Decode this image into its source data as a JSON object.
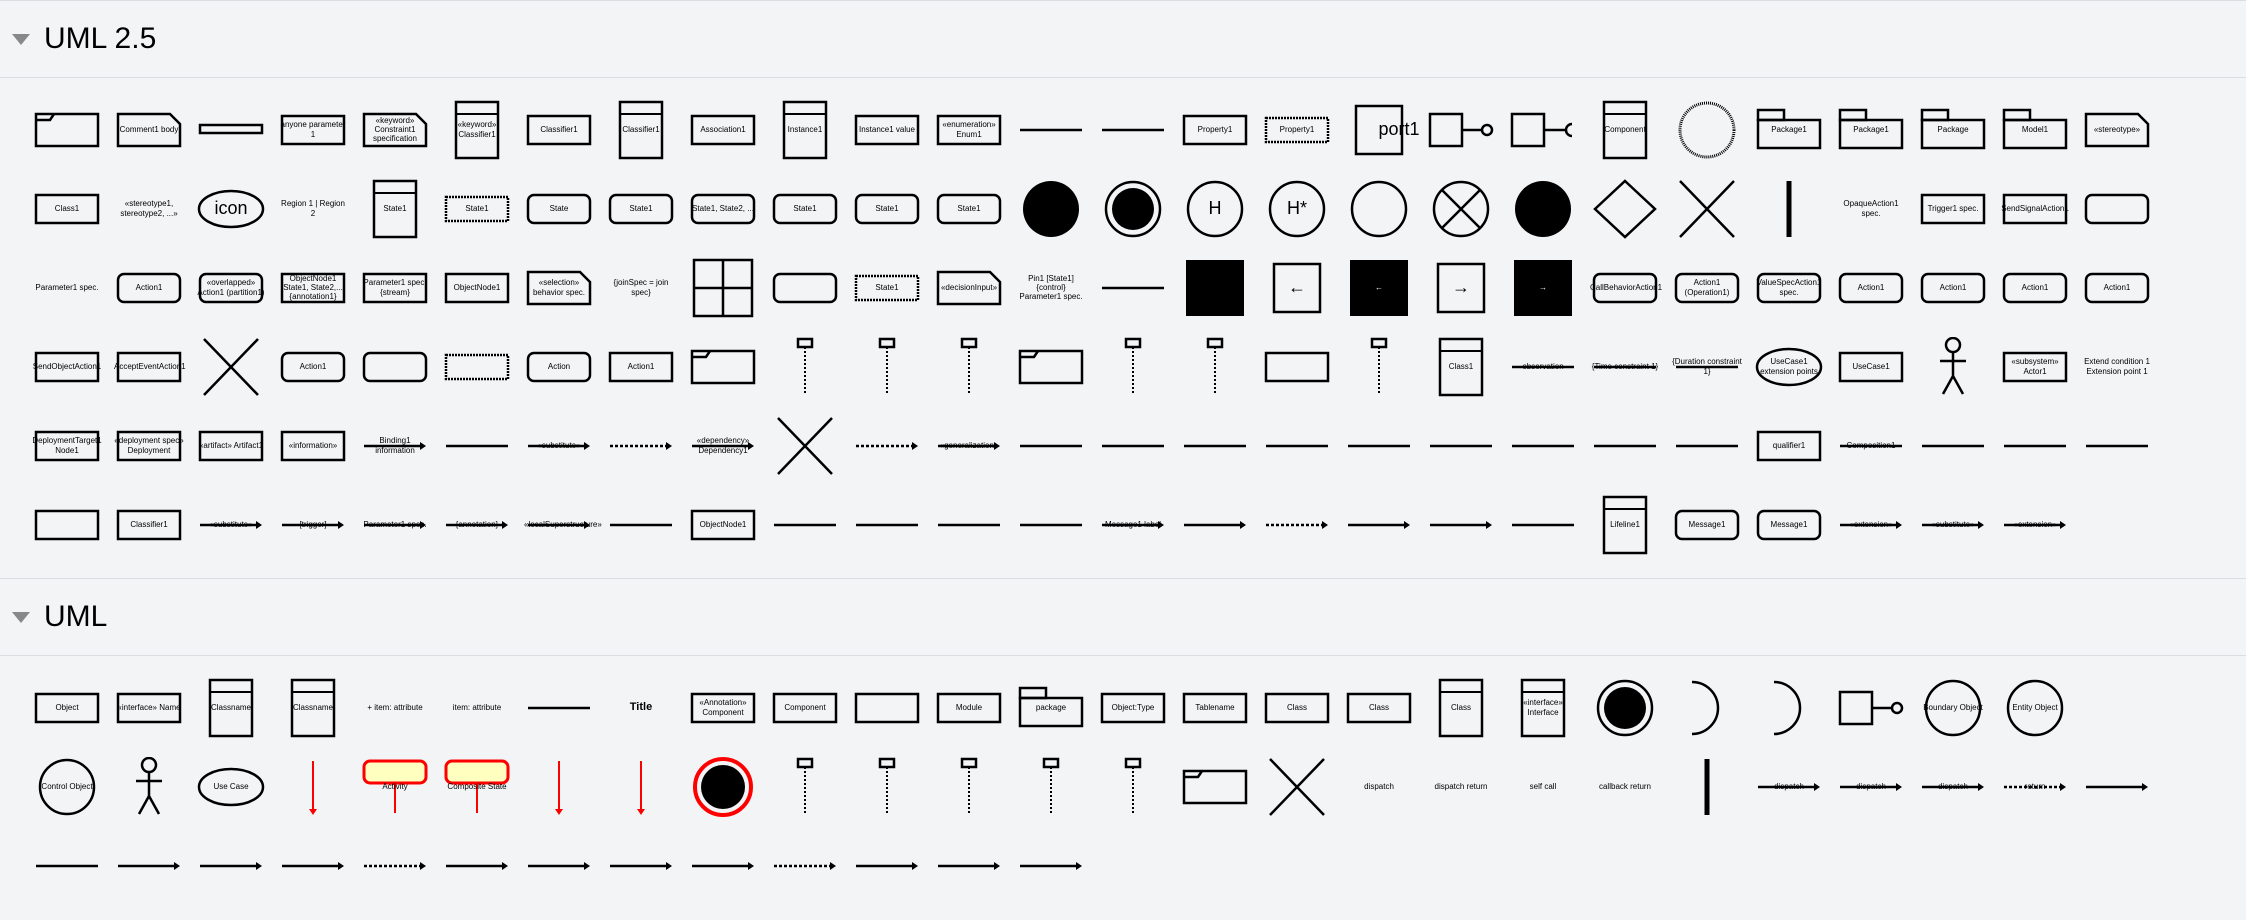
{
  "sections": [
    {
      "title": "UML 2.5",
      "rows": [
        [
          {
            "t": "frame",
            "l": ""
          },
          {
            "t": "note",
            "l": "Comment1 body"
          },
          {
            "t": "thin",
            "l": ""
          },
          {
            "t": "box",
            "l": "anyone parameter 1"
          },
          {
            "t": "note",
            "l": "«keyword» Constraint1 specification"
          },
          {
            "t": "tall",
            "l": "«keyword» Classifier1"
          },
          {
            "t": "box",
            "l": "Classifier1"
          },
          {
            "t": "tall",
            "l": "Classifier1"
          },
          {
            "t": "box",
            "l": "Association1"
          },
          {
            "t": "tall",
            "l": "Instance1"
          },
          {
            "t": "box",
            "l": "Instance1 value"
          },
          {
            "t": "box",
            "l": "«enumeration» Enum1"
          },
          {
            "t": "line",
            "l": ""
          },
          {
            "t": "line",
            "l": ""
          },
          {
            "t": "box",
            "l": "Property1"
          },
          {
            "t": "dbox",
            "l": "Property1"
          },
          {
            "t": "sq",
            "l": "port1"
          },
          {
            "t": "lollipop",
            "l": ""
          },
          {
            "t": "socket",
            "l": ""
          },
          {
            "t": "tall",
            "l": "Component"
          },
          {
            "t": "dcircle",
            "l": ""
          },
          {
            "t": "pkg",
            "l": "Package1"
          },
          {
            "t": "pkg",
            "l": "Package1"
          },
          {
            "t": "pkg",
            "l": "Package"
          },
          {
            "t": "pkg",
            "l": "Model1"
          },
          {
            "t": "note",
            "l": "«stereotype»"
          }
        ],
        [
          {
            "t": "box",
            "l": "Class1"
          },
          {
            "t": "text",
            "l": "«stereotype1, stereotype2, ...»"
          },
          {
            "t": "ellipse",
            "l": "icon"
          },
          {
            "t": "text",
            "l": "Region 1 | Region 2"
          },
          {
            "t": "tall",
            "l": "State1"
          },
          {
            "t": "dbox",
            "l": "State1"
          },
          {
            "t": "rbox",
            "l": "State"
          },
          {
            "t": "rbox",
            "l": "State1"
          },
          {
            "t": "rbox",
            "l": "State1, State2, ..."
          },
          {
            "t": "rbox",
            "l": "State1"
          },
          {
            "t": "rbox",
            "l": "State1"
          },
          {
            "t": "rbox",
            "l": "State1"
          },
          {
            "t": "filled",
            "l": ""
          },
          {
            "t": "ring",
            "l": ""
          },
          {
            "t": "circle",
            "l": "H"
          },
          {
            "t": "circle",
            "l": "H*"
          },
          {
            "t": "circle",
            "l": ""
          },
          {
            "t": "xcircle",
            "l": ""
          },
          {
            "t": "filled",
            "l": ""
          },
          {
            "t": "diamond",
            "l": ""
          },
          {
            "t": "x",
            "l": ""
          },
          {
            "t": "bar",
            "l": ""
          },
          {
            "t": "text",
            "l": "OpaqueAction1 spec."
          },
          {
            "t": "box",
            "l": "Trigger1 spec."
          },
          {
            "t": "box",
            "l": "SendSignalAction1"
          },
          {
            "t": "rbox",
            "l": ""
          }
        ],
        [
          {
            "t": "text",
            "l": "Parameter1 spec."
          },
          {
            "t": "rbox",
            "l": "Action1"
          },
          {
            "t": "rbox",
            "l": "«overlapped» Action1 (partition1)"
          },
          {
            "t": "box",
            "l": "ObjectNode1 [State1, State2,...] {annotation1}"
          },
          {
            "t": "box",
            "l": "Parameter1 spec. {stream}"
          },
          {
            "t": "box",
            "l": "ObjectNode1"
          },
          {
            "t": "note",
            "l": "«selection» behavior spec."
          },
          {
            "t": "text",
            "l": "{joinSpec = join spec}"
          },
          {
            "t": "grid",
            "l": ""
          },
          {
            "t": "rbox",
            "l": ""
          },
          {
            "t": "dbox",
            "l": "State1"
          },
          {
            "t": "note",
            "l": "«decisionInput»"
          },
          {
            "t": "text",
            "l": "Pin1 [State1] {control} Parameter1 spec."
          },
          {
            "t": "line",
            "l": ""
          },
          {
            "t": "fsq",
            "l": ""
          },
          {
            "t": "sq",
            "l": "←"
          },
          {
            "t": "fsq",
            "l": "←"
          },
          {
            "t": "sq",
            "l": "→"
          },
          {
            "t": "fsq",
            "l": "→"
          },
          {
            "t": "rbox",
            "l": "CallBehaviorAction1"
          },
          {
            "t": "rbox",
            "l": "Action1 (Operation1)"
          },
          {
            "t": "rbox",
            "l": "ValueSpecAction1 spec."
          },
          {
            "t": "rbox",
            "l": "Action1"
          },
          {
            "t": "rbox",
            "l": "Action1"
          },
          {
            "t": "rbox",
            "l": "Action1"
          },
          {
            "t": "rbox",
            "l": "Action1"
          }
        ],
        [
          {
            "t": "box",
            "l": "SendObjectAction1"
          },
          {
            "t": "box",
            "l": "AcceptEventAction1"
          },
          {
            "t": "x",
            "l": ""
          },
          {
            "t": "rbox",
            "l": "Action1"
          },
          {
            "t": "rbox",
            "l": ""
          },
          {
            "t": "dbox",
            "l": ""
          },
          {
            "t": "rbox",
            "l": "Action"
          },
          {
            "t": "box",
            "l": "Action1"
          },
          {
            "t": "frame",
            "l": ""
          },
          {
            "t": "lifeline",
            "l": ""
          },
          {
            "t": "lifeline",
            "l": ""
          },
          {
            "t": "lifeline",
            "l": ""
          },
          {
            "t": "frame",
            "l": ""
          },
          {
            "t": "lifeline",
            "l": ""
          },
          {
            "t": "lifeline",
            "l": ""
          },
          {
            "t": "box",
            "l": ""
          },
          {
            "t": "lifeline",
            "l": ""
          },
          {
            "t": "tall",
            "l": "Class1"
          },
          {
            "t": "line",
            "l": "observation"
          },
          {
            "t": "line",
            "l": "{Time constraint 1}"
          },
          {
            "t": "line",
            "l": "{Duration constraint 1}"
          },
          {
            "t": "ellipse",
            "l": "UseCase1 extension points"
          },
          {
            "t": "box",
            "l": "UseCase1"
          },
          {
            "t": "actor",
            "l": ""
          },
          {
            "t": "box",
            "l": "«subsystem» Actor1"
          },
          {
            "t": "text",
            "l": "Extend condition 1 Extension point 1"
          }
        ],
        [
          {
            "t": "box",
            "l": "DeploymentTarget1 Node1"
          },
          {
            "t": "box",
            "l": "«deployment spec» Deployment"
          },
          {
            "t": "box",
            "l": "«artifact» Artifact1"
          },
          {
            "t": "box",
            "l": "«information»"
          },
          {
            "t": "arrow",
            "l": "Binding1 information"
          },
          {
            "t": "line",
            "l": ""
          },
          {
            "t": "arrow",
            "l": "«substitute»"
          },
          {
            "t": "dashed",
            "l": ""
          },
          {
            "t": "arrow",
            "l": "«dependency» Dependency1"
          },
          {
            "t": "x",
            "l": ""
          },
          {
            "t": "dashed",
            "l": ""
          },
          {
            "t": "arrow",
            "l": "«generalization»"
          },
          {
            "t": "line",
            "l": ""
          },
          {
            "t": "line",
            "l": ""
          },
          {
            "t": "line",
            "l": ""
          },
          {
            "t": "line",
            "l": ""
          },
          {
            "t": "line",
            "l": ""
          },
          {
            "t": "line",
            "l": ""
          },
          {
            "t": "line",
            "l": ""
          },
          {
            "t": "line",
            "l": ""
          },
          {
            "t": "line",
            "l": ""
          },
          {
            "t": "box",
            "l": "qualifier1"
          },
          {
            "t": "line",
            "l": "Composition1"
          },
          {
            "t": "line",
            "l": ""
          },
          {
            "t": "line",
            "l": ""
          },
          {
            "t": "line",
            "l": ""
          }
        ],
        [
          {
            "t": "box",
            "l": ""
          },
          {
            "t": "box",
            "l": "Classifier1"
          },
          {
            "t": "arrow",
            "l": "«substitute»"
          },
          {
            "t": "arrow",
            "l": "[trigger]"
          },
          {
            "t": "arrow",
            "l": "Parameter1 spec."
          },
          {
            "t": "arrow",
            "l": "{annotation}"
          },
          {
            "t": "arrow",
            "l": "«localSuperstructure»"
          },
          {
            "t": "line",
            "l": ""
          },
          {
            "t": "box",
            "l": "ObjectNode1"
          },
          {
            "t": "line",
            "l": ""
          },
          {
            "t": "line",
            "l": ""
          },
          {
            "t": "line",
            "l": ""
          },
          {
            "t": "line",
            "l": ""
          },
          {
            "t": "arrow",
            "l": "Message1 label"
          },
          {
            "t": "arrow",
            "l": ""
          },
          {
            "t": "dashed",
            "l": ""
          },
          {
            "t": "arrow",
            "l": ""
          },
          {
            "t": "arrow",
            "l": ""
          },
          {
            "t": "line",
            "l": ""
          },
          {
            "t": "tall",
            "l": "Lifeline1"
          },
          {
            "t": "rbox",
            "l": "Message1"
          },
          {
            "t": "rbox",
            "l": "Message1"
          },
          {
            "t": "arrow",
            "l": "«extension»"
          },
          {
            "t": "arrow",
            "l": "«substitute»"
          },
          {
            "t": "arrow",
            "l": "«extension»"
          }
        ]
      ]
    },
    {
      "title": "UML",
      "rows": [
        [
          {
            "t": "box",
            "l": "Object"
          },
          {
            "t": "box",
            "l": "«interface» Name"
          },
          {
            "t": "tall",
            "l": "Classname"
          },
          {
            "t": "tall",
            "l": "Classname"
          },
          {
            "t": "text",
            "l": "+ item: attribute"
          },
          {
            "t": "text",
            "l": "item: attribute"
          },
          {
            "t": "line",
            "l": ""
          },
          {
            "t": "bold",
            "l": "Title"
          },
          {
            "t": "box",
            "l": "«Annotation» Component"
          },
          {
            "t": "box",
            "l": "Component"
          },
          {
            "t": "box",
            "l": ""
          },
          {
            "t": "box",
            "l": "Module"
          },
          {
            "t": "pkg",
            "l": "package"
          },
          {
            "t": "box",
            "l": "Object:Type"
          },
          {
            "t": "box",
            "l": "Tablename"
          },
          {
            "t": "box",
            "l": "Class"
          },
          {
            "t": "box",
            "l": "Class"
          },
          {
            "t": "tall",
            "l": "Class"
          },
          {
            "t": "tall",
            "l": "«interface» Interface"
          },
          {
            "t": "ring",
            "l": ""
          },
          {
            "t": "arc",
            "l": ""
          },
          {
            "t": "arc",
            "l": ""
          },
          {
            "t": "lollipop",
            "l": ""
          },
          {
            "t": "circle",
            "l": "Boundary Object"
          },
          {
            "t": "circle",
            "l": "Entity Object"
          }
        ],
        [
          {
            "t": "circle",
            "l": "Control Object"
          },
          {
            "t": "actor",
            "l": ""
          },
          {
            "t": "ellipse",
            "l": "Use Case"
          },
          {
            "t": "redline",
            "l": ""
          },
          {
            "t": "yellow",
            "l": "Activity"
          },
          {
            "t": "yellow",
            "l": "Composite State"
          },
          {
            "t": "redline",
            "l": ""
          },
          {
            "t": "redline",
            "l": ""
          },
          {
            "t": "redring",
            "l": ""
          },
          {
            "t": "lifeline",
            "l": ""
          },
          {
            "t": "lifeline",
            "l": ""
          },
          {
            "t": "lifeline",
            "l": ""
          },
          {
            "t": "lifeline",
            "l": ""
          },
          {
            "t": "lifeline",
            "l": ""
          },
          {
            "t": "frame",
            "l": ""
          },
          {
            "t": "x",
            "l": ""
          },
          {
            "t": "text",
            "l": "dispatch"
          },
          {
            "t": "text",
            "l": "dispatch return"
          },
          {
            "t": "text",
            "l": "self call"
          },
          {
            "t": "text",
            "l": "callback return"
          },
          {
            "t": "bar",
            "l": ""
          },
          {
            "t": "arrow",
            "l": "dispatch"
          },
          {
            "t": "arrow",
            "l": "dispatch"
          },
          {
            "t": "arrow",
            "l": "dispatch"
          },
          {
            "t": "dashed",
            "l": "return"
          },
          {
            "t": "arrow",
            "l": ""
          }
        ],
        [
          {
            "t": "line",
            "l": ""
          },
          {
            "t": "arrow",
            "l": ""
          },
          {
            "t": "arrow",
            "l": ""
          },
          {
            "t": "arrow",
            "l": ""
          },
          {
            "t": "dashed",
            "l": ""
          },
          {
            "t": "arrow",
            "l": ""
          },
          {
            "t": "arrow",
            "l": ""
          },
          {
            "t": "arrow",
            "l": ""
          },
          {
            "t": "arrow",
            "l": ""
          },
          {
            "t": "dashed",
            "l": ""
          },
          {
            "t": "arrow",
            "l": ""
          },
          {
            "t": "arrow",
            "l": ""
          },
          {
            "t": "arrow",
            "l": ""
          }
        ]
      ]
    }
  ],
  "colors": {
    "background": "#f3f4f6",
    "stroke": "#000000",
    "activity_red": "#ff0000",
    "activity_fill": "#ffffc0"
  }
}
